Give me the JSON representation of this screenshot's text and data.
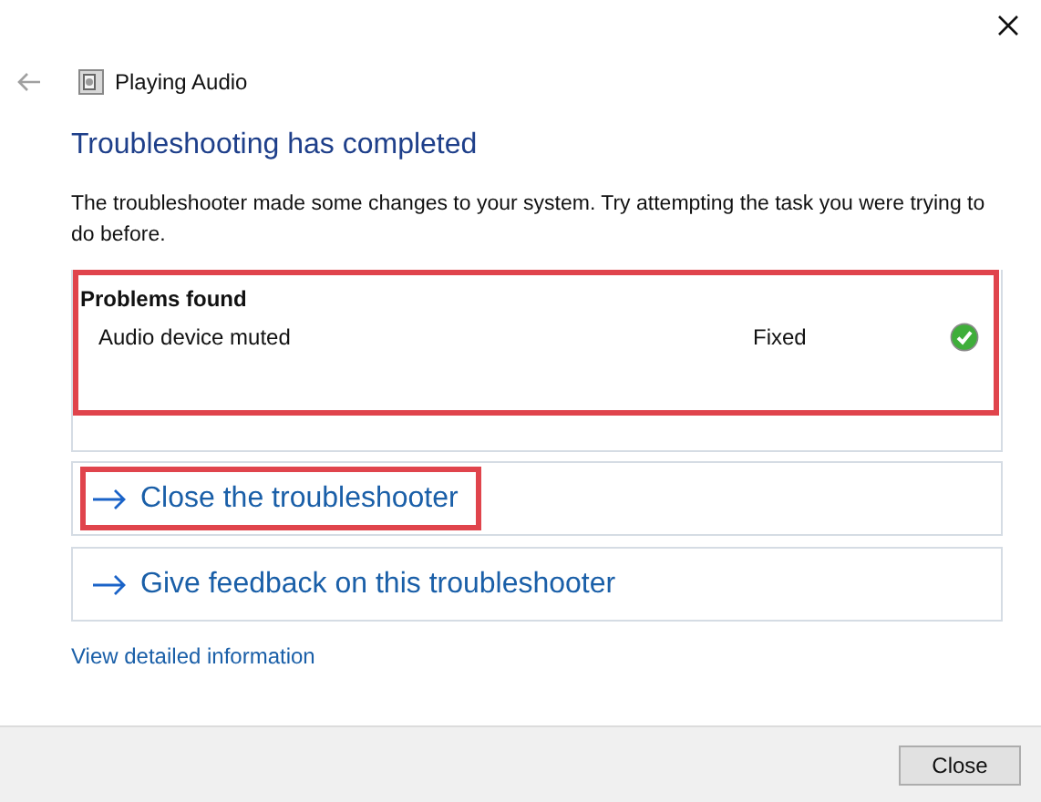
{
  "window": {
    "title": "Playing Audio"
  },
  "heading": "Troubleshooting has completed",
  "message": "The troubleshooter made some changes to your system. Try attempting the task you were trying to do before.",
  "problems": {
    "title": "Problems found",
    "highlighted": true,
    "items": [
      {
        "name": "Audio device muted",
        "status": "Fixed",
        "fixed": true
      }
    ]
  },
  "actions": [
    {
      "label": "Close the troubleshooter",
      "highlighted": true
    },
    {
      "label": "Give feedback on this troubleshooter",
      "highlighted": false
    }
  ],
  "details_link": "View detailed information",
  "buttons": [
    "Close"
  ]
}
